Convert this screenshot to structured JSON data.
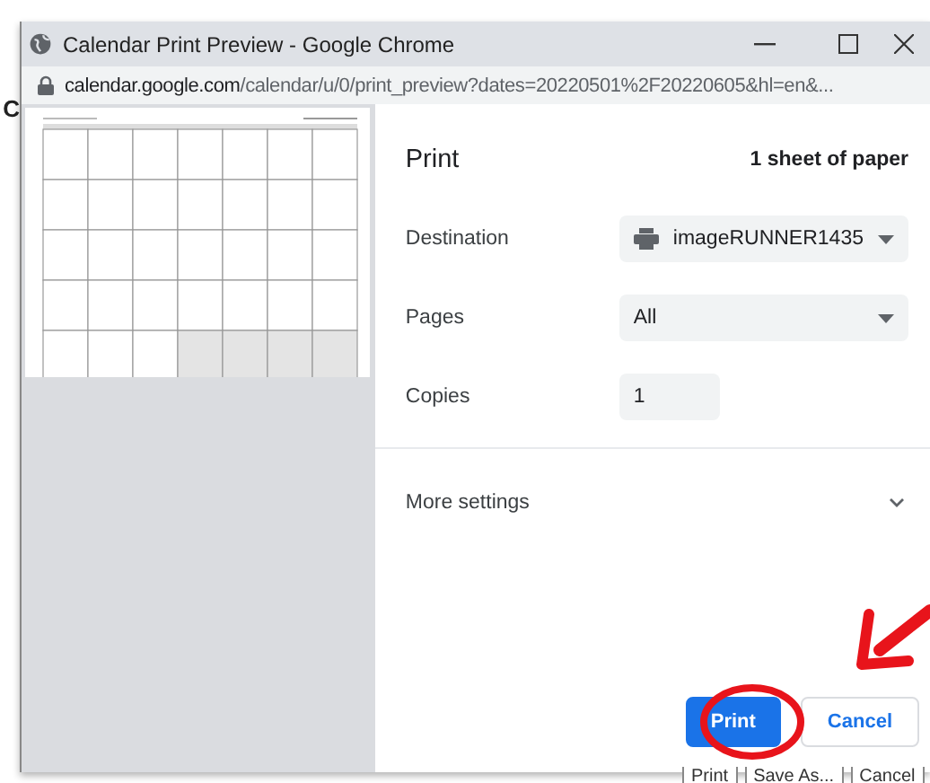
{
  "background_letter": "C",
  "window": {
    "title": "Calendar Print Preview - Google Chrome",
    "url_host": "calendar.google.com",
    "url_path": "/calendar/u/0/print_preview?dates=20220501%2F20220605&hl=en&..."
  },
  "print_panel": {
    "title": "Print",
    "sheets": "1 sheet of paper",
    "settings": [
      {
        "kind": "select",
        "label": "Destination",
        "value": "imageRUNNER1435"
      },
      {
        "kind": "select",
        "label": "Pages",
        "value": "All"
      },
      {
        "kind": "input",
        "label": "Copies",
        "value": "1"
      }
    ],
    "more_settings": {
      "label": "More settings",
      "expanded": false
    },
    "buttons": [
      {
        "label": "Print",
        "primary": true
      },
      {
        "label": "Cancel",
        "primary": false
      }
    ]
  },
  "page_buttons": [
    "Print",
    "Save As...",
    "Cancel"
  ]
}
